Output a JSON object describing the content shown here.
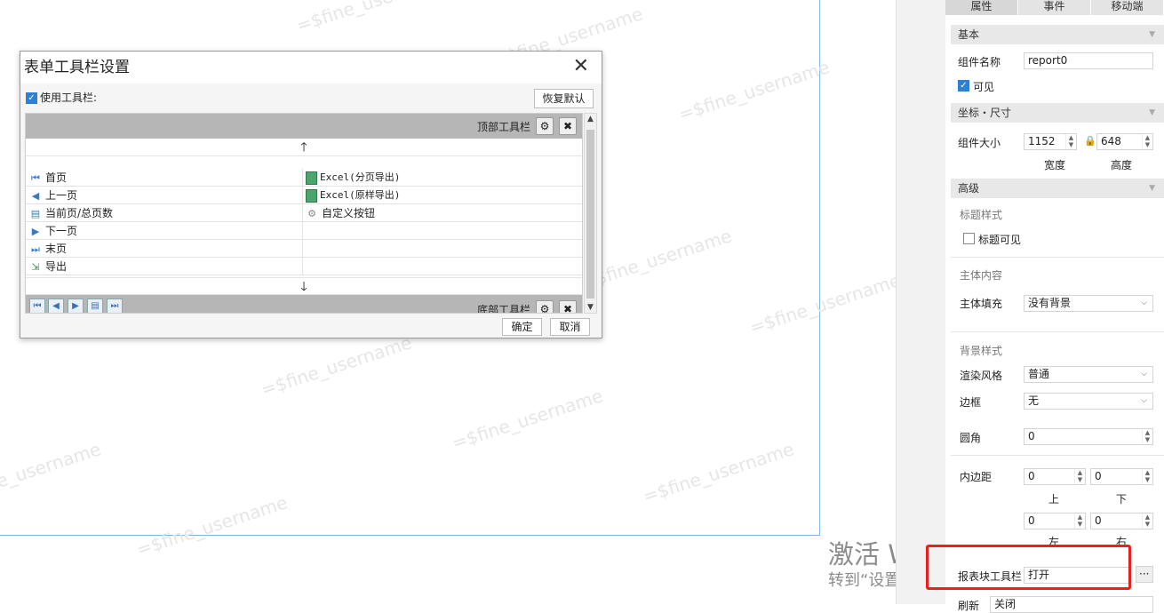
{
  "watermark": "=$fine_username",
  "dialog": {
    "title": "表单工具栏设置",
    "use_toolbar_label": "使用工具栏:",
    "restore_button": "恢复默认",
    "top_bar_label": "顶部工具栏",
    "bottom_bar_label": "底部工具栏",
    "up_arrow": "🡑",
    "down_arrow": "🡓",
    "rows": [
      {
        "left": "首页",
        "right": "Excel(分页导出)"
      },
      {
        "left": "上一页",
        "right": "Excel(原样导出)"
      },
      {
        "left": "当前页/总页数",
        "right": "自定义按钮"
      },
      {
        "left": "下一页",
        "right": ""
      },
      {
        "left": "末页",
        "right": ""
      },
      {
        "left": "导出",
        "right": ""
      }
    ],
    "ok_button": "确定",
    "cancel_button": "取消"
  },
  "panel": {
    "tabs": [
      "属性",
      "事件",
      "移动端"
    ],
    "basic": {
      "section": "基本",
      "name_label": "组件名称",
      "name_value": "report0",
      "visible_label": "可见"
    },
    "position": {
      "section": "坐标・尺寸",
      "size_label": "组件大小",
      "width_value": "1152",
      "height_value": "648",
      "width_label": "宽度",
      "height_label": "高度"
    },
    "advanced": {
      "section": "高级",
      "title_style": "标题样式",
      "title_visible": "标题可见",
      "body_content": "主体内容",
      "body_fill_label": "主体填充",
      "body_fill_value": "没有背景",
      "bg_style": "背景样式",
      "render_label": "渲染风格",
      "render_value": "普通",
      "border_label": "边框",
      "border_value": "无",
      "radius_label": "圆角",
      "radius_value": "0",
      "padding_label": "内边距",
      "pad_top": "0",
      "pad_bottom": "0",
      "pad_left": "0",
      "pad_right": "0",
      "top_label": "上",
      "bottom_label": "下",
      "left_label": "左",
      "right_label": "右",
      "toolbar_label": "报表块工具栏",
      "toolbar_value": "打开",
      "toolbar_more": "···",
      "refresh_label": "刷新",
      "refresh_value": "关闭"
    }
  },
  "activate_windows": {
    "line1": "激活 Windows",
    "line2": "转到“设置”以激活 Windows。"
  }
}
